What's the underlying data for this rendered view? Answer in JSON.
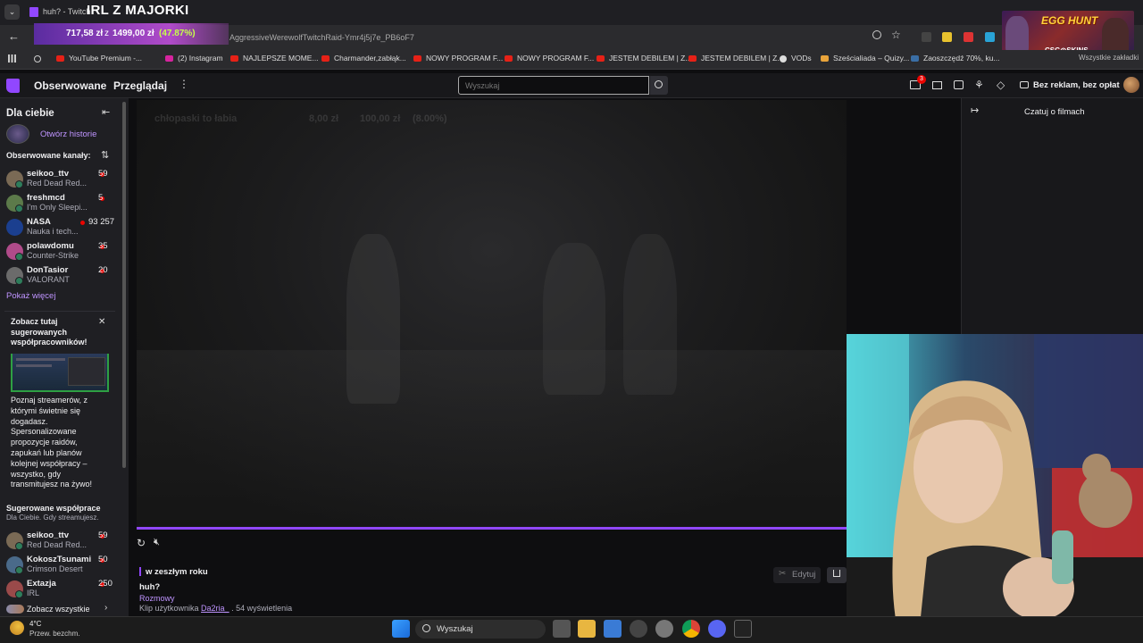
{
  "browser": {
    "tab_title": "huh? - Twitch",
    "url_visible": "AggressiveWerewolfTwitchRaid-Ymr4j5j7e_PB6oF7",
    "bookmarks": [
      {
        "label": "YouTube Premium -..."
      },
      {
        "label": "(2) Instagram"
      },
      {
        "label": "NAJLEPSZE MOME..."
      },
      {
        "label": "Charmander,zabłąk..."
      },
      {
        "label": "NOWY PROGRAM F..."
      },
      {
        "label": "NOWY PROGRAM F..."
      },
      {
        "label": "JESTEM DEBILEM | Z..."
      },
      {
        "label": "JESTEM DEBILEM | Z..."
      },
      {
        "label": "VODs"
      },
      {
        "label": "Sześcialiada – Quizy..."
      },
      {
        "label": "Zaoszczędź 70%, ku..."
      }
    ],
    "bookmarks_overflow": "Wszystkie zakładki"
  },
  "overlay": {
    "stream_title": "IRL Z MAJORKI",
    "donation_current": "717,58 zł",
    "donation_sep": "z",
    "donation_goal": "1499,00 zł",
    "donation_pct": "(47.87%)",
    "banner_title": "EGG HUNT",
    "banner_sponsor": "CSG◎SKINS"
  },
  "twitch_nav": {
    "following": "Obserwowane",
    "browse": "Przeglądaj",
    "search_placeholder": "Wyszukaj",
    "notif_count": "3",
    "no_ads": "Bez reklam, bez opłat"
  },
  "sidebar": {
    "for_you": "Dla ciebie",
    "open_history": "Otwórz historie",
    "followed_header": "Obserwowane kanały:",
    "followed": [
      {
        "name": "seikoo_ttv",
        "game": "Red Dead Red...",
        "viewers": "59",
        "color": "#7a6a55"
      },
      {
        "name": "freshmcd",
        "game": "I'm Only Sleepi...",
        "viewers": "5",
        "color": "#5c7a4a"
      },
      {
        "name": "NASA",
        "game": "Nauka i tech...",
        "viewers": "93 257",
        "color": "#1b3f8f"
      },
      {
        "name": "polawdomu",
        "game": "Counter-Strike",
        "viewers": "35",
        "color": "#b04b8a"
      },
      {
        "name": "DonTasior",
        "game": "VALORANT",
        "viewers": "20",
        "color": "#6b6b6b"
      }
    ],
    "show_more": "Pokaż więcej",
    "promo_title": "Zobacz tutaj sugerowanych współpracowników!",
    "promo_body": "Poznaj streamerów, z którymi świetnie się dogadasz. Spersonalizowane propozycje raidów, zapukań lub planów kolejnej współpracy – wszystko, gdy transmitujesz na żywo!",
    "suggested_header": "Sugerowane współprace",
    "suggested_sub": "Dla Ciebie. Gdy streamujesz.",
    "suggested": [
      {
        "name": "seikoo_ttv",
        "game": "Red Dead Red...",
        "viewers": "59",
        "color": "#7a6a55"
      },
      {
        "name": "KokoszTsunami",
        "game": "Crimson Desert",
        "viewers": "50",
        "color": "#4a6a8a"
      },
      {
        "name": "Extazja",
        "game": "IRL",
        "viewers": "250",
        "color": "#9a4a4a"
      }
    ],
    "see_all": "Zobacz wszystkie"
  },
  "player": {
    "ghost_overlay_name": "chłopaski to łabia",
    "ghost_overlay_amount1": "8,00 zł",
    "ghost_overlay_amount2": "100,00 zł",
    "ghost_overlay_pct": "(8.00%)",
    "progress": 1.0
  },
  "clip": {
    "date": "w zeszłym roku",
    "title": "huh?",
    "category": "Rozmowy",
    "by_prefix": "Klip użytkownika",
    "author": "Da2ria_",
    "views": ". 54 wyświetlenia",
    "edit": "Edytuj"
  },
  "chat": {
    "label": "Czatuj o filmach"
  },
  "taskbar": {
    "temp": "4°C",
    "weather": "Przew. bezchm.",
    "search": "Wyszukaj"
  },
  "colors": {
    "accent": "#9147ff",
    "link": "#bf94ff",
    "live": "#eb0400"
  }
}
